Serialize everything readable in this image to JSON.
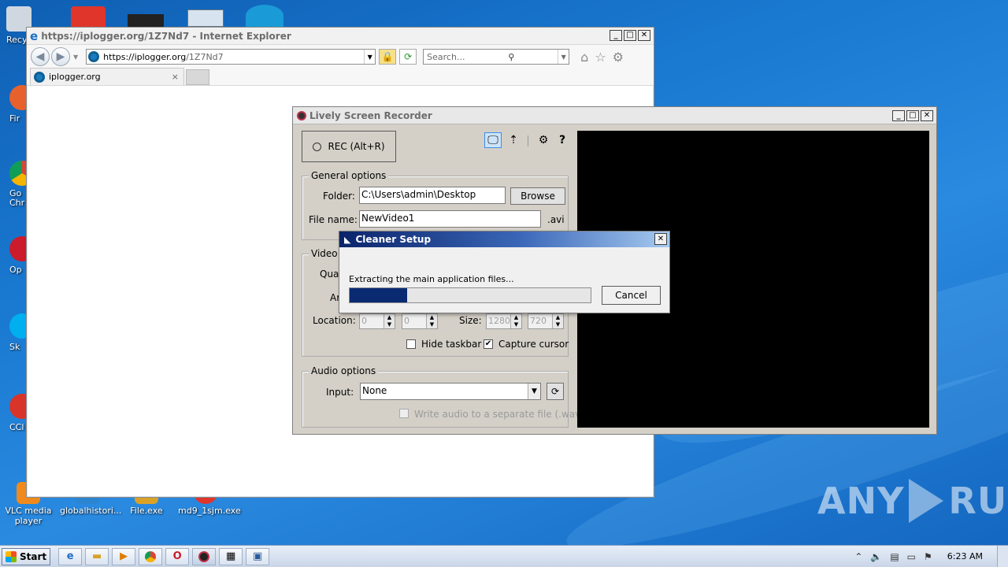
{
  "desktop": {
    "icons": [
      {
        "label": "VLC media player",
        "color": "#f08a1c"
      },
      {
        "label": "globalhistori...",
        "color": "#2c85d1"
      },
      {
        "label": "File.exe",
        "color": "#d9a227"
      },
      {
        "label": "md9_1sjm.exe",
        "color": "#e0352b"
      }
    ],
    "partial_labels": [
      "Recy",
      "Fir",
      "Go Chr",
      "Op",
      "Sk",
      "CCl"
    ]
  },
  "ie": {
    "title": "https://iplogger.org/1Z7Nd7 - Internet Explorer",
    "address_host": "https://iplogger.org",
    "address_path": "/1Z7Nd7",
    "search_placeholder": "Search...",
    "tab_label": "iplogger.org",
    "tab_close": "×",
    "icons": [
      "back-icon",
      "forward-icon",
      "lock-icon",
      "refresh-icon",
      "search-icon",
      "home-icon",
      "favorites-icon",
      "tools-icon"
    ]
  },
  "recorder": {
    "title": "Lively Screen Recorder",
    "rec_label": "REC (Alt+R)",
    "general_options": "General options",
    "folder_label": "Folder:",
    "folder_value": "C:\\Users\\admin\\Desktop",
    "browse_label": "Browse",
    "filename_label": "File name:",
    "filename_value": "NewVideo1",
    "ext_label": ".avi",
    "video_options_partial": "Video o",
    "quality_partial": "Qual",
    "area_partial": "Ar",
    "location_label": "Location:",
    "loc_x": "0",
    "loc_y": "0",
    "size_label": "Size:",
    "size_w": "1280",
    "size_h": "720",
    "hide_taskbar": "Hide taskbar",
    "hide_taskbar_checked": false,
    "capture_cursor": "Capture cursor",
    "capture_cursor_checked": true,
    "audio_options": "Audio options",
    "input_label": "Input:",
    "input_value": "None",
    "write_audio": "Write audio to a separate file (.wav)",
    "write_audio_checked": false
  },
  "setup": {
    "title": "Cleaner Setup",
    "status": "Extracting the main application files...",
    "cancel_label": "Cancel",
    "progress_fraction": 0.24,
    "progress_color": "#0a2a72"
  },
  "watermark": {
    "left": "ANY",
    "right": "RUN"
  },
  "taskbar": {
    "start_label": "Start",
    "buttons": [
      "ie-icon",
      "explorer-icon",
      "media-icon",
      "chrome-icon",
      "opera-icon",
      "recorder-icon",
      "setup-icon",
      "installer-icon"
    ],
    "clock": "6:23 AM"
  }
}
